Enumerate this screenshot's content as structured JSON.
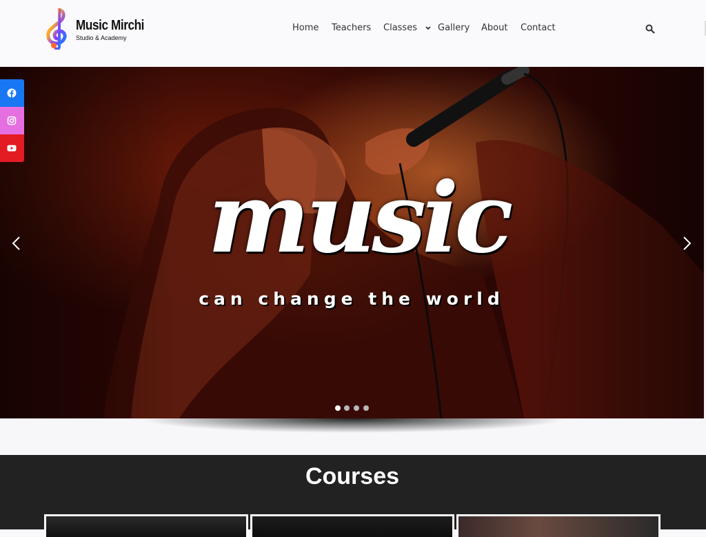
{
  "brand": {
    "name": "Music Mirchi",
    "tagline": "Studio & Academy"
  },
  "nav": {
    "items": [
      {
        "label": "Home"
      },
      {
        "label": "Teachers"
      },
      {
        "label": "Classes"
      },
      {
        "label": "Gallery"
      },
      {
        "label": "About"
      },
      {
        "label": "Contact"
      }
    ]
  },
  "hero": {
    "title": "music",
    "subtitle": "can change the world",
    "active_slide": 1,
    "slide_count": 4
  },
  "social": [
    {
      "icon": "facebook-icon",
      "color": "#1877f2"
    },
    {
      "icon": "instagram-icon",
      "color": "#e56fe0"
    },
    {
      "icon": "youtube-icon",
      "color": "#e31b23"
    }
  ],
  "courses": {
    "title": "Courses"
  },
  "colors": {
    "header_bg": "#fafafd",
    "courses_bg": "#222222"
  }
}
